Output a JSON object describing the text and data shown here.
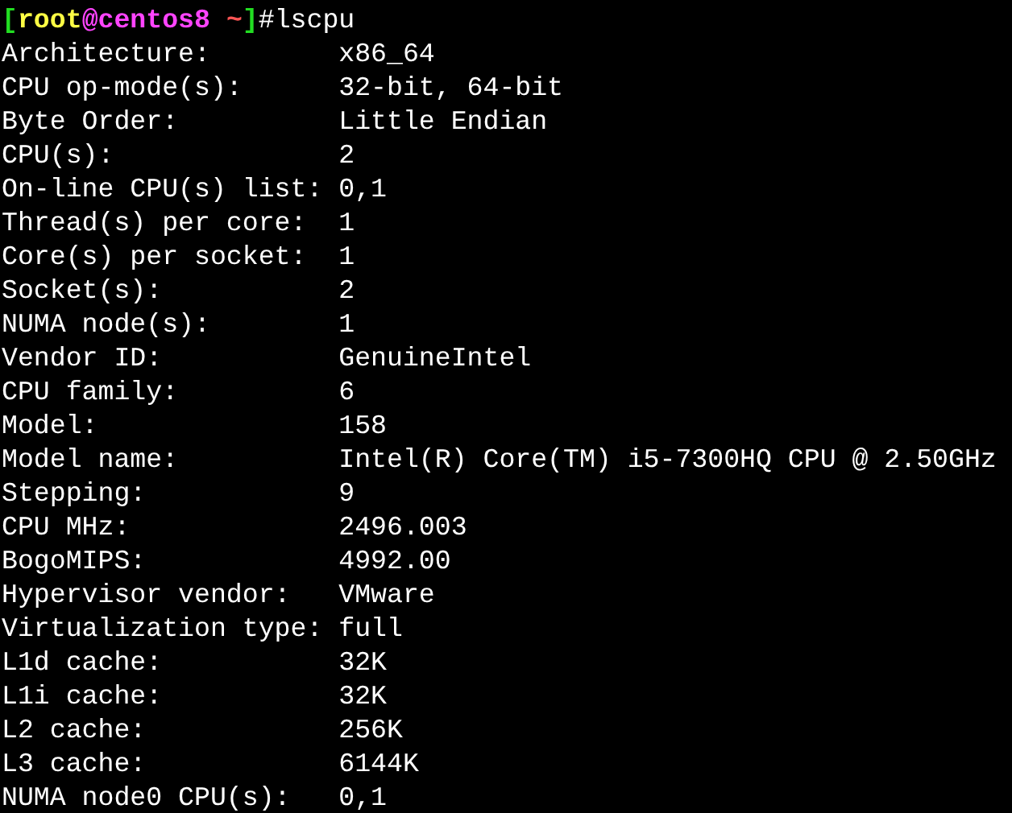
{
  "prompt": [
    {
      "text": "[",
      "color": "#22dd22"
    },
    {
      "text": "root",
      "color": "#ffff44"
    },
    {
      "text": "@centos8",
      "color": "#ff44ff"
    },
    {
      "text": " ~",
      "color": "#ff5555"
    },
    {
      "text": "]",
      "color": "#22dd22"
    },
    {
      "text": "#lscpu",
      "color": "#ffffff"
    }
  ],
  "rows": [
    {
      "label": "Architecture:",
      "value": "x86_64"
    },
    {
      "label": "CPU op-mode(s):",
      "value": "32-bit, 64-bit"
    },
    {
      "label": "Byte Order:",
      "value": "Little Endian"
    },
    {
      "label": "CPU(s):",
      "value": "2"
    },
    {
      "label": "On-line CPU(s) list:",
      "value": "0,1"
    },
    {
      "label": "Thread(s) per core:",
      "value": "1"
    },
    {
      "label": "Core(s) per socket:",
      "value": "1"
    },
    {
      "label": "Socket(s):",
      "value": "2"
    },
    {
      "label": "NUMA node(s):",
      "value": "1"
    },
    {
      "label": "Vendor ID:",
      "value": "GenuineIntel"
    },
    {
      "label": "CPU family:",
      "value": "6"
    },
    {
      "label": "Model:",
      "value": "158"
    },
    {
      "label": "Model name:",
      "value": "Intel(R) Core(TM) i5-7300HQ CPU @ 2.50GHz"
    },
    {
      "label": "Stepping:",
      "value": "9"
    },
    {
      "label": "CPU MHz:",
      "value": "2496.003"
    },
    {
      "label": "BogoMIPS:",
      "value": "4992.00"
    },
    {
      "label": "Hypervisor vendor:",
      "value": "VMware"
    },
    {
      "label": "Virtualization type:",
      "value": "full"
    },
    {
      "label": "L1d cache:",
      "value": "32K"
    },
    {
      "label": "L1i cache:",
      "value": "32K"
    },
    {
      "label": "L2 cache:",
      "value": "256K"
    },
    {
      "label": "L3 cache:",
      "value": "6144K"
    },
    {
      "label": "NUMA node0 CPU(s):",
      "value": "0,1"
    }
  ]
}
